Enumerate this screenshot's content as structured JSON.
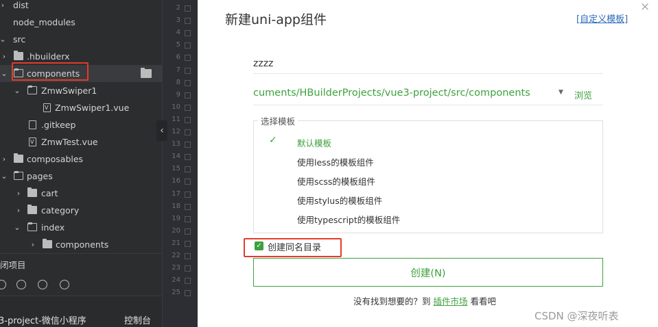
{
  "file_tree": {
    "items": [
      {
        "label": "dist",
        "expanded": false
      },
      {
        "label": "node_modules",
        "expanded": false
      },
      {
        "label": "src",
        "expanded": true
      },
      {
        "label": ".hbuilderx",
        "expanded": false
      },
      {
        "label": "components",
        "expanded": true
      },
      {
        "label": "ZmwSwiper1",
        "expanded": true
      },
      {
        "label": "ZmwSwiper1.vue"
      },
      {
        "label": ".gitkeep"
      },
      {
        "label": "ZmwTest.vue"
      },
      {
        "label": "composables",
        "expanded": false
      },
      {
        "label": "pages",
        "expanded": true
      },
      {
        "label": "cart",
        "expanded": false
      },
      {
        "label": "category",
        "expanded": false
      },
      {
        "label": "index",
        "expanded": true
      },
      {
        "label": "components",
        "expanded": false
      }
    ],
    "close_project_label": "闭项目",
    "project_name": "3-project-微信小程序",
    "console_label": "控制台"
  },
  "editor": {
    "line_numbers": [
      "2",
      "3",
      "4",
      "5",
      "6",
      "7",
      "8",
      "9",
      "10",
      "11",
      "12",
      "13",
      "14",
      "15",
      "16",
      "17",
      "18",
      "19",
      "20",
      "21",
      "22",
      "23",
      "24",
      "25"
    ]
  },
  "dialog": {
    "title": "新建uni-app组件",
    "custom_template_link": "[自定义模板]",
    "close_icon": "×",
    "name_value": "zzzz",
    "path_value": "cuments/HBuilderProjects/vue3-project/src/components",
    "browse_label": "浏览",
    "template_group_label": "选择模板",
    "templates": [
      {
        "label": "默认模板",
        "selected": true
      },
      {
        "label": "使用less的模板组件"
      },
      {
        "label": "使用scss的模板组件"
      },
      {
        "label": "使用stylus的模板组件"
      },
      {
        "label": "使用typescript的模板组件"
      }
    ],
    "same_dir_label": "创建同名目录",
    "same_dir_checked": true,
    "create_button_label": "创建(N)",
    "footer_prefix": "没有找到想要的？到",
    "footer_link": "插件市场",
    "footer_suffix": "看看吧"
  },
  "watermark": "CSDN @深夜听表",
  "colors": {
    "accent_green": "#3da13d",
    "highlight_red": "#e43b2a",
    "link_blue": "#2a69b9",
    "sidebar_bg": "#2c2d2f"
  }
}
